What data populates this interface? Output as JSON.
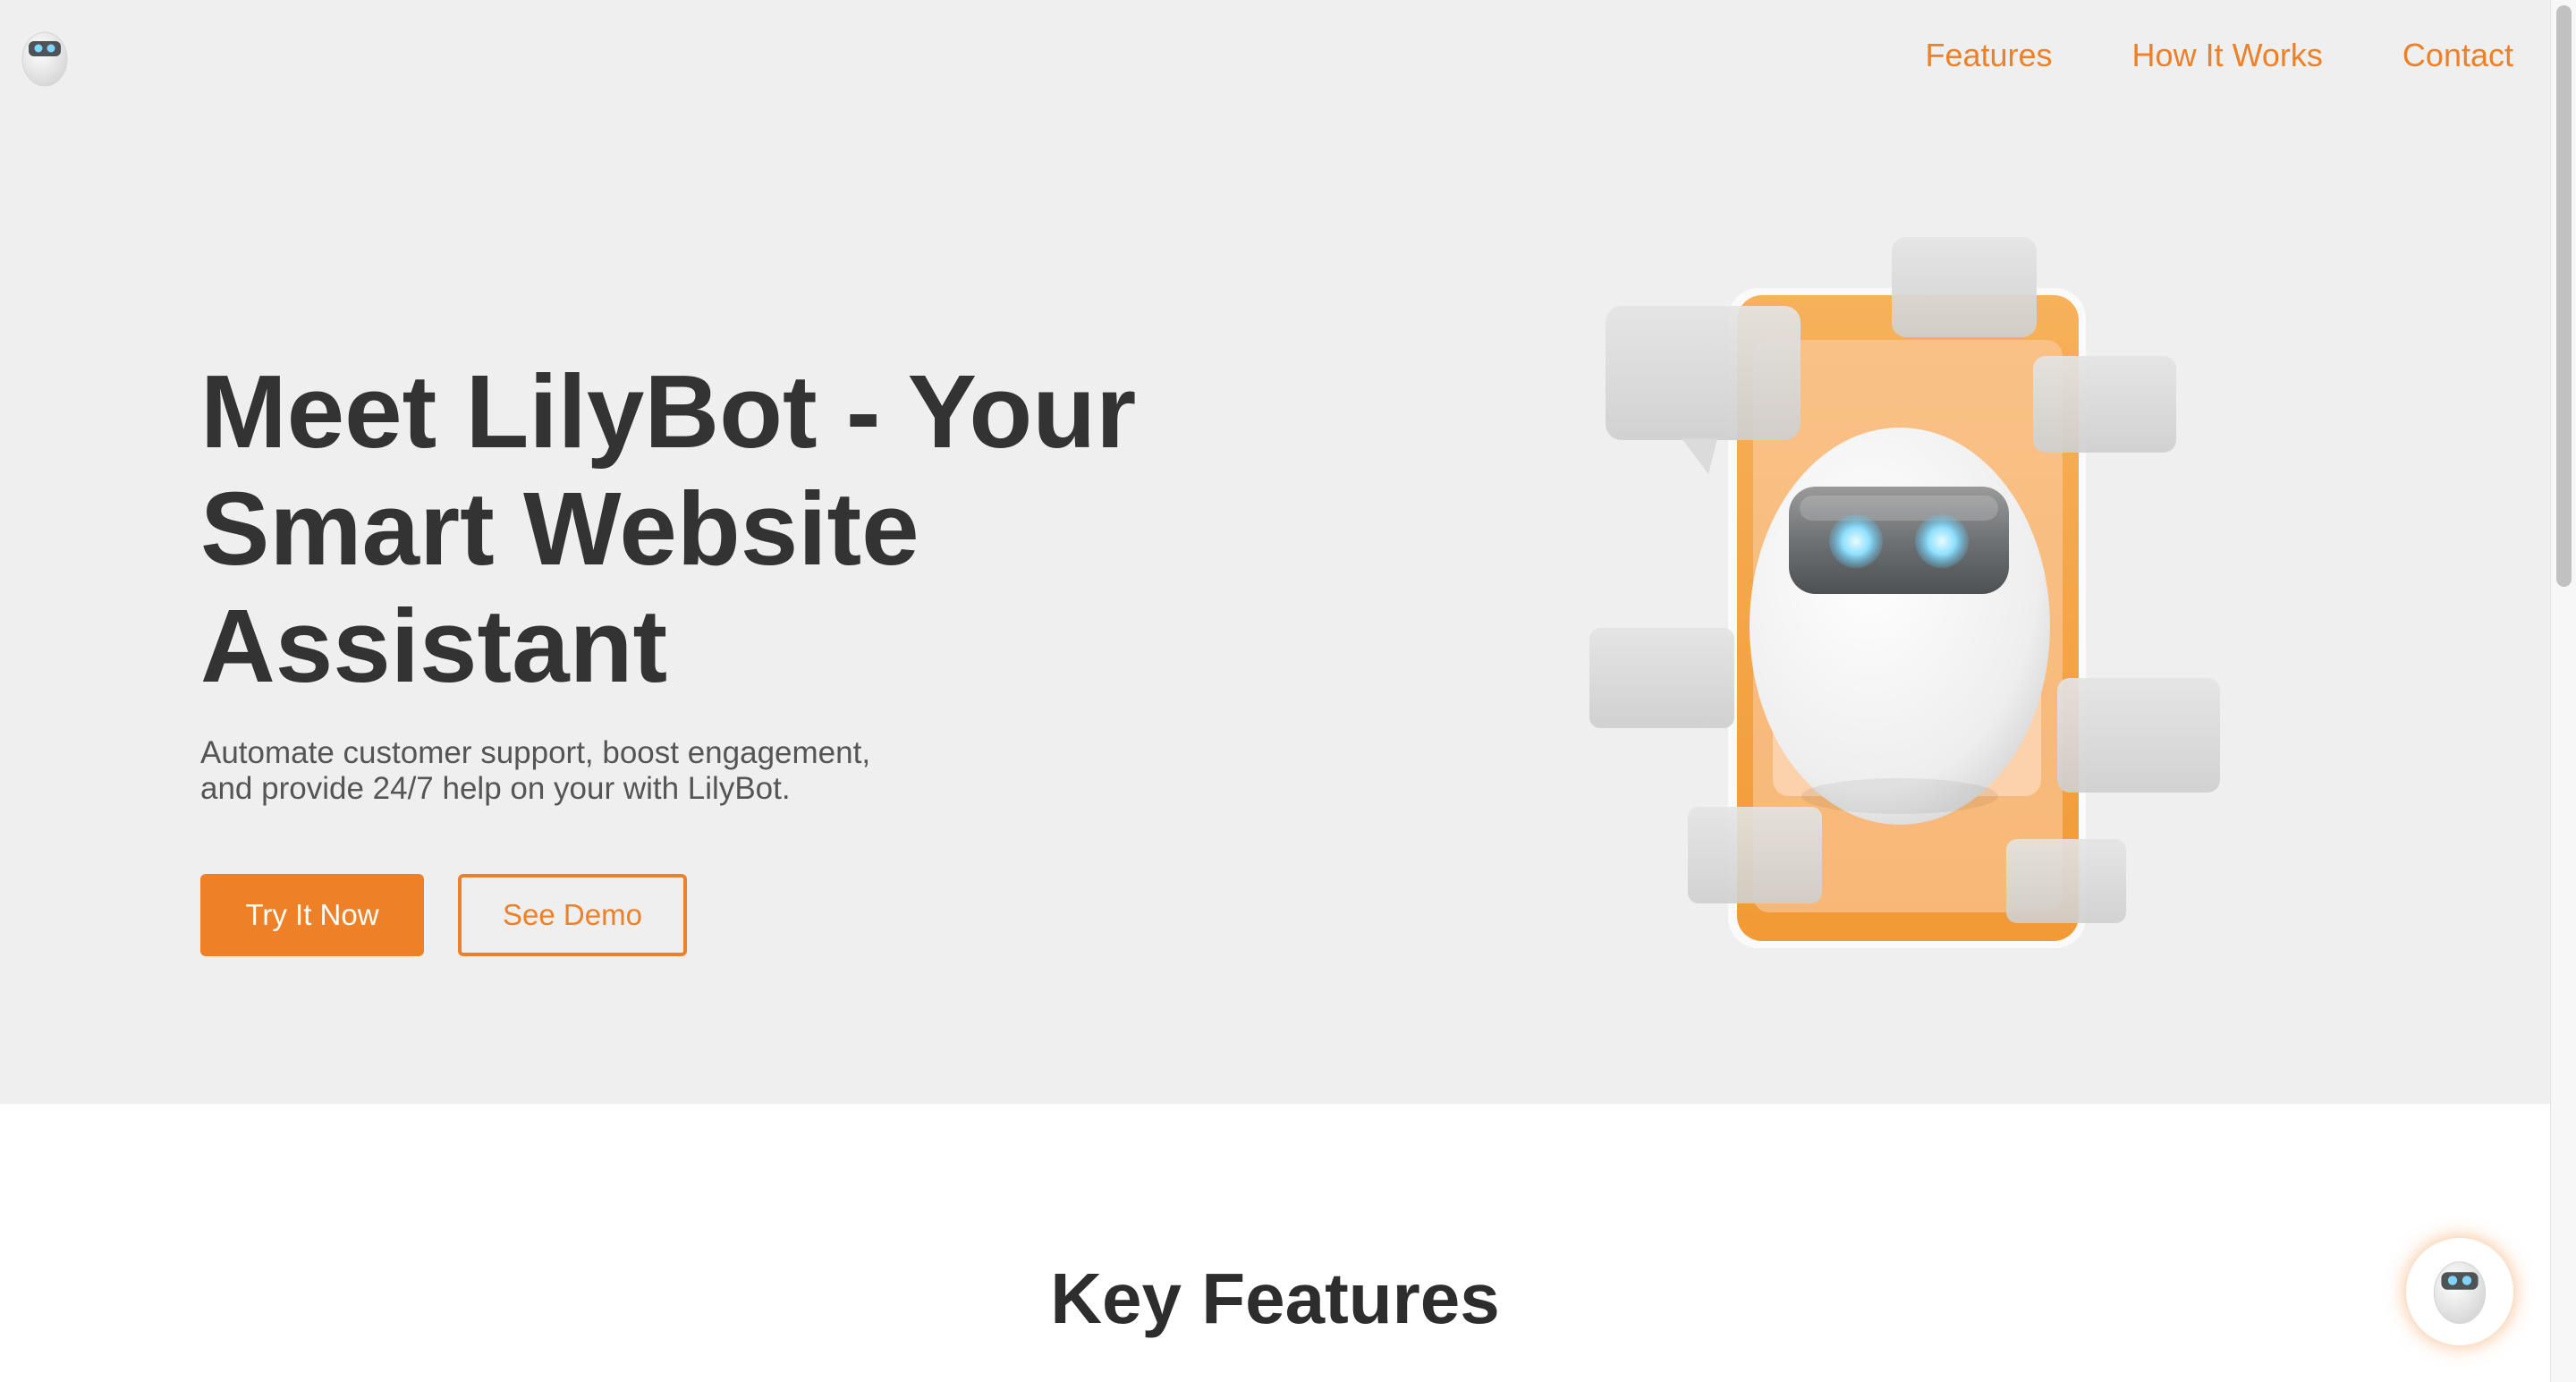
{
  "header": {
    "logo_icon": "robot-head-icon",
    "nav": [
      {
        "label": "Features"
      },
      {
        "label": "How It Works"
      },
      {
        "label": "Contact"
      }
    ]
  },
  "hero": {
    "title": "Meet LilyBot - Your Smart Website Assistant",
    "subtitle": "Automate customer support, boost engagement, and provide 24/7 help on your with LilyBot.",
    "primary_button": "Try It Now",
    "secondary_button": "See Demo",
    "illustration_icon": "robot-phone-chat-illustration"
  },
  "features": {
    "title": "Key Features"
  },
  "chat_widget": {
    "icon": "robot-head-icon"
  },
  "colors": {
    "accent": "#ee8027",
    "hero_background": "#efefef",
    "heading_text": "#333333",
    "body_text": "#555555"
  }
}
